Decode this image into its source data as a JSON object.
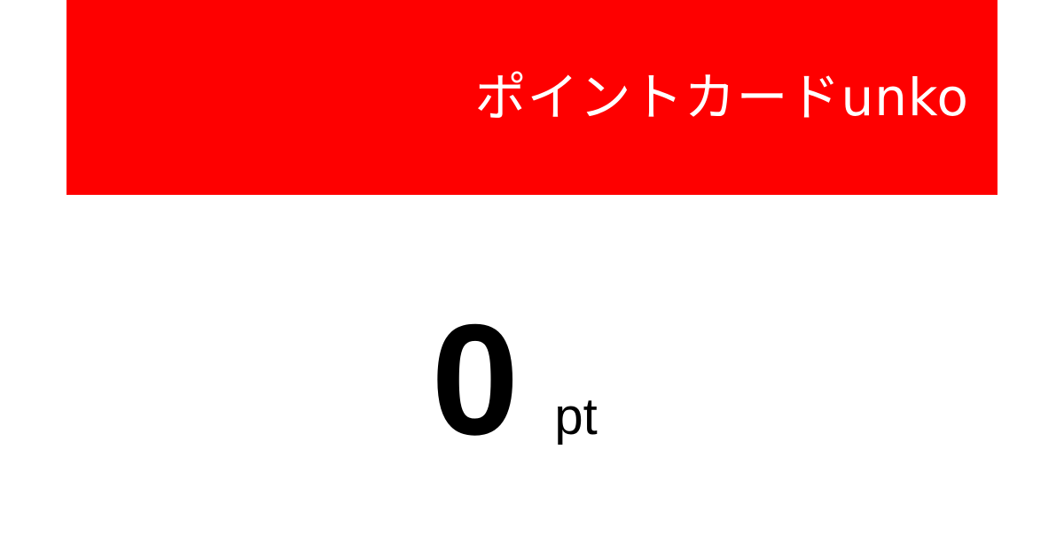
{
  "header": {
    "title": "ポイントカードunko"
  },
  "points": {
    "value": "0",
    "unit": "pt"
  },
  "colors": {
    "header_background": "#fe0000",
    "header_text": "#ffffff",
    "body_background": "#ffffff",
    "points_text": "#000000"
  }
}
